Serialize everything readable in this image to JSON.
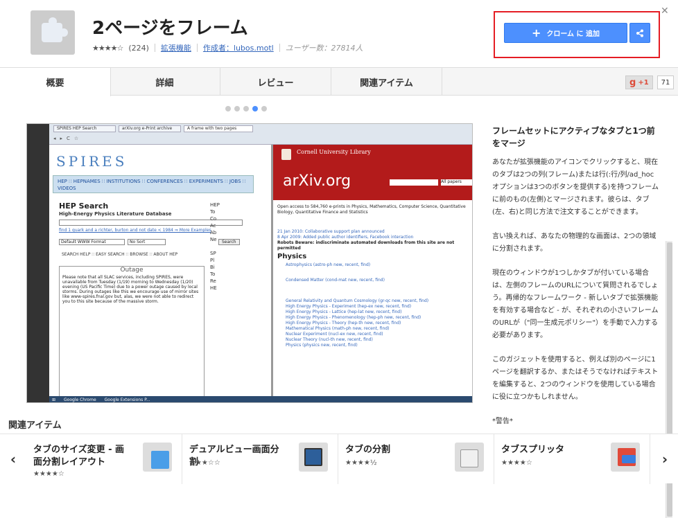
{
  "header": {
    "title": "2ページをフレーム",
    "rating_stars": "★★★★☆",
    "rating_count": "(224)",
    "category_link": "拡張機能",
    "author_link": "作成者：lubos.motl",
    "users": "ユーザー数：27814人",
    "add_button_label": "クローム に 追加",
    "close_label": "✕"
  },
  "tabs": [
    {
      "label": "概要"
    },
    {
      "label": "詳細"
    },
    {
      "label": "レビュー"
    },
    {
      "label": "関連アイテム"
    }
  ],
  "gplus": {
    "label": "+1",
    "count": "71"
  },
  "screenshot": {
    "browser_tabs": [
      "SPIRES HEP Search",
      "arXiv.org e-Print archive",
      "A frame with two pages"
    ],
    "spires_logo": "SPIRES",
    "spires_nav": "HEP ∷ HEPNAMES ∷ INSTITUTIONS ∷ CONFERENCES ∷ EXPERIMENTS ∷ JOBS ∷ VIDEOS",
    "hep_title": "HEP Search",
    "hep_subtitle": "High-Energy Physics Literature Database",
    "hep_link": "find 1 quark and a richter, burton and not date < 1984 ⇒ More Examples",
    "hep_format": "Default WWW Format",
    "hep_sort": "No Sort",
    "hep_search_btn": "Search",
    "hep_help": "SEARCH HELP ∷ EASY SEARCH ∷ BROWSE ∷ ABOUT HEP",
    "outage_title": "Outage",
    "outage_text": "Please note that all SLAC services, including SPIRES, were unavailable from Tuesday (1/19) morning to Wednesday (1/20) evening (US Pacific Time) due to a power outage caused by local storms. During outages like this we encourage use of mirror sites like www-spires.fnal.gov but, alas, we were not able to redirect you to this site because of the massive storm.",
    "arxiv_cornell": "Cornell University Library",
    "arxiv_logo": "arXiv.org",
    "arxiv_all": "All papers",
    "arxiv_intro": "Open access to 584,760 e-prints in Physics, Mathematics, Computer Science, Quantitative Biology, Quantitative Finance and Statistics",
    "arxiv_news1": "21 Jan 2010: Collaborative support plan announced",
    "arxiv_news2": "8 Apr 2009: Added public author identifiers, Facebook interaction",
    "arxiv_robots": "Robots Beware: indiscriminate automated downloads from this site are not permitted",
    "physics_heading": "Physics",
    "physics_items": [
      "Astrophysics (astro-ph new, recent, find)",
      "Condensed Matter (cond-mat new, recent, find)",
      "General Relativity and Quantum Cosmology (gr-qc new, recent, find)",
      "High Energy Physics - Experiment (hep-ex new, recent, find)",
      "High Energy Physics - Lattice (hep-lat new, recent, find)",
      "High Energy Physics - Phenomenology (hep-ph new, recent, find)",
      "High Energy Physics - Theory (hep-th new, recent, find)",
      "Mathematical Physics (math-ph new, recent, find)",
      "Nuclear Experiment (nucl-ex new, recent, find)",
      "Nuclear Theory (nucl-th new, recent, find)",
      "Physics (physics new, recent, find)"
    ],
    "taskbar_items": [
      "Google Chrome",
      "Google Extensions P..."
    ]
  },
  "description": {
    "heading": "フレームセットにアクティブなタブと1つ前をマージ",
    "p1": "あなたが拡張機能のアイコンでクリックすると、現在のタブは2つの列(フレーム)または行(:行/列/ad_hocオプションは3つのボタンを提供する)を持つフレームに前のもの(左側)とマージされます。彼らは、タブ(左、右)と同じ方法で注文することができます。",
    "p2": "言い換えれば、あなたの物理的な画面は、2つの領域に分割されます。",
    "p3": "現在のウィンドウが1つしかタブが付いている場合は、左側のフレームのURLについて質問されるでしょう。再帰的なフレームワーク - 新しいタブで拡張機能を有効する場合など - が、それぞれの小さいフレームのURLが（\"同一生成元ポリシー\"）を手動で入力する必要があります。",
    "p4": "このガジェットを使用すると、例えば別のページに1ページを翻訳するか、またはそうでなければテキストを編集すると、2つのウィンドウを使用している場合に役に立つかもしれません。",
    "p5": "*警告*"
  },
  "related": {
    "label": "関連アイテム",
    "cards": [
      {
        "name": "タブのサイズ変更 - 画面分割レイアウト",
        "stars": "★★★★☆"
      },
      {
        "name": "デュアルビュー画面分割",
        "stars": "★★★☆☆"
      },
      {
        "name": "タブの分割",
        "stars": "★★★★½"
      },
      {
        "name": "タブスプリッタ",
        "stars": "★★★★☆"
      }
    ],
    "prev": "‹",
    "next": "›"
  }
}
